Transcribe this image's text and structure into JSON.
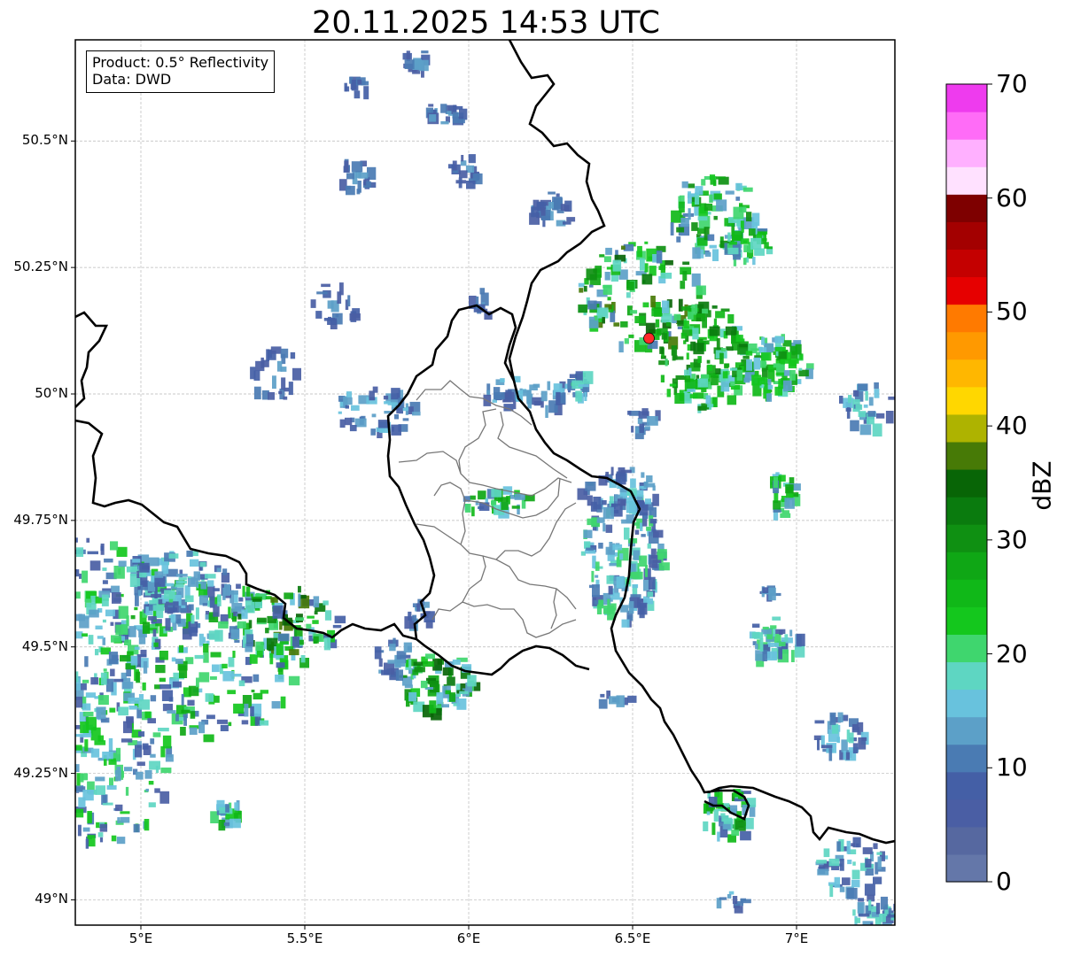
{
  "title": "20.11.2025 14:53 UTC",
  "info": {
    "product": "Product: 0.5° Reflectivity",
    "source": "Data: DWD"
  },
  "lat_labels": [
    "50.5°N",
    "50.25°N",
    "50°N",
    "49.75°N",
    "49.5°N",
    "49.25°N",
    "49°N"
  ],
  "lat_values": [
    50.5,
    50.25,
    50.0,
    49.75,
    49.5,
    49.25,
    49.0
  ],
  "lon_labels": [
    "5°E",
    "5.5°E",
    "6°E",
    "6.5°E",
    "7°E"
  ],
  "lon_values": [
    5.0,
    5.5,
    6.0,
    6.5,
    7.0
  ],
  "extent": {
    "lon": [
      4.8,
      7.3
    ],
    "lat": [
      48.95,
      50.7
    ]
  },
  "radar_site": {
    "lon": 6.55,
    "lat": 50.11,
    "color": "#ff2a2a"
  },
  "colorbar": {
    "unit": "dBZ",
    "min": 0,
    "max": 70,
    "labels": [
      "0",
      "10",
      "20",
      "30",
      "40",
      "50",
      "60",
      "70"
    ],
    "colors": [
      "#6477a9",
      "#5668a0",
      "#4a5ea4",
      "#445fa6",
      "#4a7bb3",
      "#5ca0c8",
      "#68c2dd",
      "#5ed6c2",
      "#3fd66e",
      "#14c71d",
      "#10b818",
      "#0fa715",
      "#0f9012",
      "#0a7b0e",
      "#086506",
      "#477a06",
      "#aeb300",
      "#ffd700",
      "#ffb700",
      "#ff9900",
      "#ff7a00",
      "#e60000",
      "#c40000",
      "#a30000",
      "#7e0000",
      "#ffe1ff",
      "#ffb0ff",
      "#ff6cf7",
      "#ee3bee"
    ]
  }
}
